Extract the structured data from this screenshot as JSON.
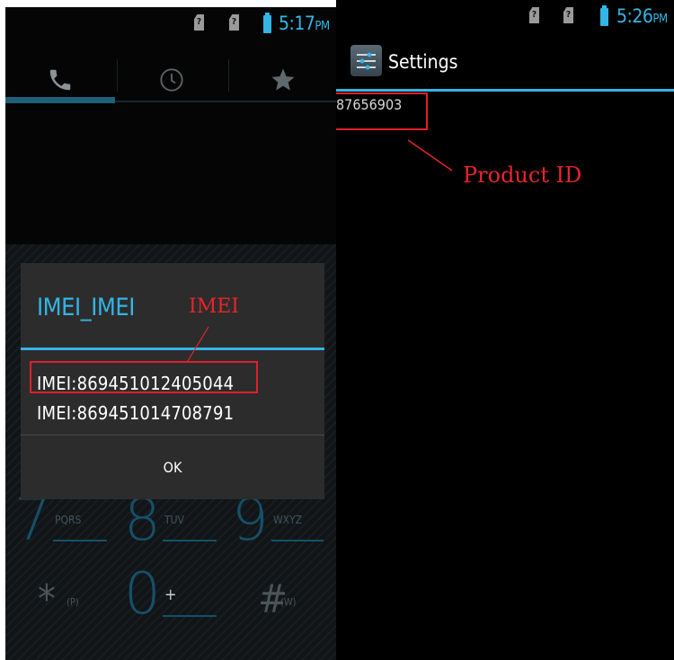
{
  "left": {
    "status_time": "5:17",
    "status_ampm": "PM",
    "sim_glyph": "?",
    "tabs": [
      {
        "name": "phone-tab",
        "icon": "phone-icon"
      },
      {
        "name": "recent-tab",
        "icon": "clock-icon"
      },
      {
        "name": "favorites-tab",
        "icon": "star-icon"
      }
    ],
    "dialog": {
      "title": "IMEI_IMEI",
      "imei1": "IMEI:869451012405044",
      "imei2": "IMEI:869451014708791",
      "ok_label": "OK"
    },
    "dialpad": {
      "k7": "7",
      "k7_letters": "PQRS",
      "k8": "8",
      "k8_letters": "TUV",
      "k9": "9",
      "k9_letters": "WXYZ",
      "star": "*",
      "star_sub": "(P)",
      "k0": "0",
      "k0_sub": "+",
      "hash": "#",
      "hash_sub": "(W)"
    },
    "annotation_label": "IMEI"
  },
  "right": {
    "status_time": "5:26",
    "status_ampm": "PM",
    "sim_glyph": "?",
    "title": "Settings",
    "product_id": "87656903",
    "annotation_label": "Product ID"
  },
  "colors": {
    "accent": "#33b5e5",
    "annotation": "#e8242b",
    "dialog_bg": "#2c2c2c"
  }
}
